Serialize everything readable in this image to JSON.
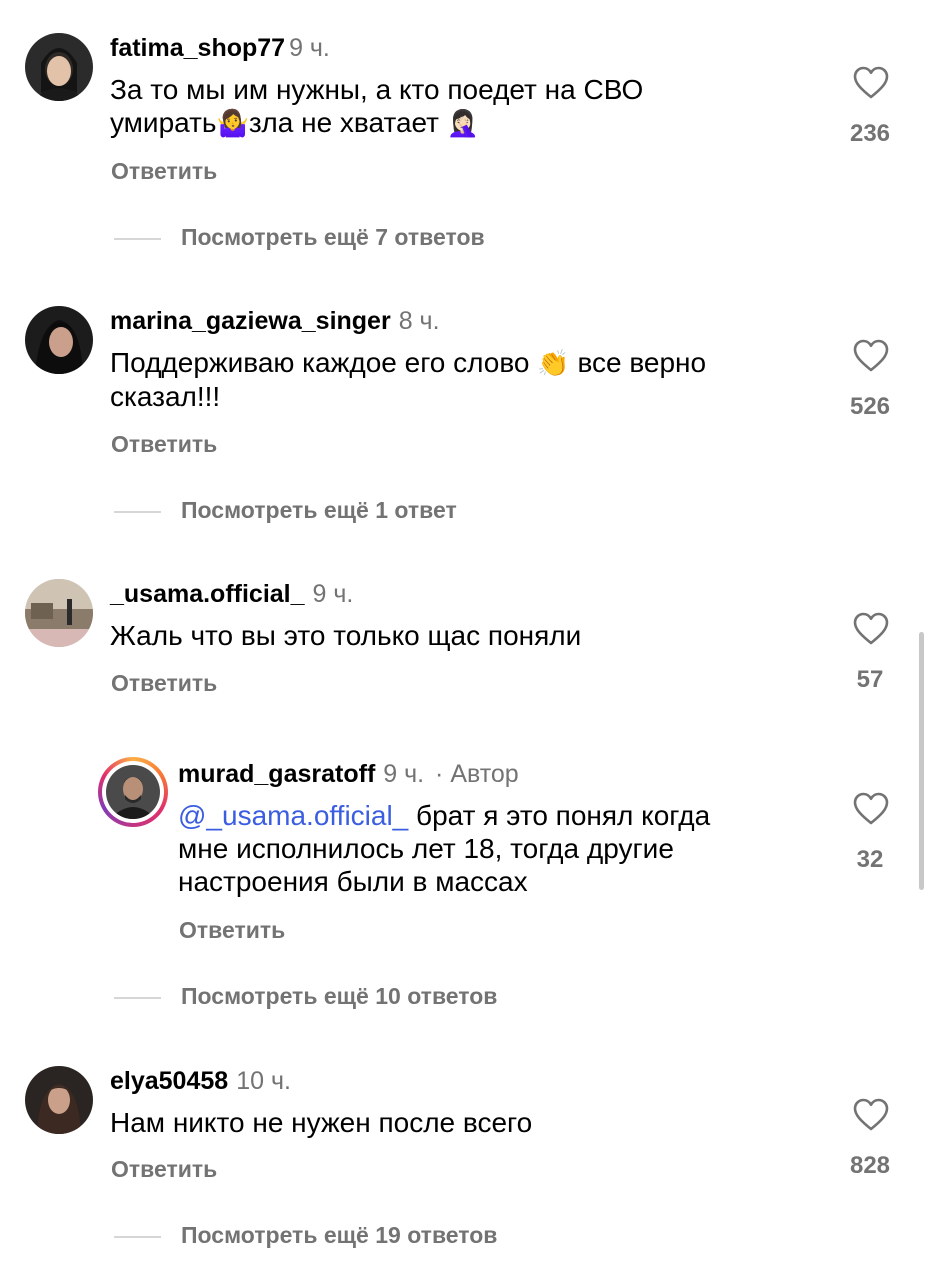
{
  "reply_label": "Ответить",
  "comments": [
    {
      "username": "fatima_shop77",
      "time": "9 ч.",
      "text_line1": "За то мы им нужны, а кто поедет на СВО",
      "text_line2a": "умирать",
      "emoji_a": "🤷‍♀️",
      "text_line2b": "зла не хватает",
      "emoji_b": "🤦🏻‍♀️",
      "likes": "236",
      "more_replies": "Посмотреть ещё 7 ответов"
    },
    {
      "username": "marina_gaziewa_singer",
      "time": "8 ч.",
      "text_a": "Поддерживаю каждое его слово",
      "emoji": "👏",
      "text_b": "все верно",
      "text_line2": "сказал!!!",
      "likes": "526",
      "more_replies": "Посмотреть ещё 1 ответ"
    },
    {
      "username": "_usama.official_",
      "time": "9 ч.",
      "text": "Жаль что вы это только щас поняли",
      "likes": "57"
    },
    {
      "username": "murad_gasratoff",
      "time": "9 ч.",
      "author_tag": "· Автор",
      "mention": "@_usama.official_",
      "text_line1": "брат я это понял когда",
      "text_line2": "мне исполнилось лет 18, тогда другие",
      "text_line3": "настроения были в массах",
      "likes": "32",
      "more_replies": "Посмотреть ещё 10 ответов"
    },
    {
      "username": "elya50458",
      "time": "10 ч.",
      "text": "Нам никто не нужен после всего",
      "likes": "828",
      "more_replies": "Посмотреть ещё 19 ответов"
    }
  ],
  "colors": {
    "secondary_text": "#737373",
    "mention": "#3b5ee0",
    "divider": "#d6d6d6"
  },
  "icons": [
    "heart-icon"
  ]
}
